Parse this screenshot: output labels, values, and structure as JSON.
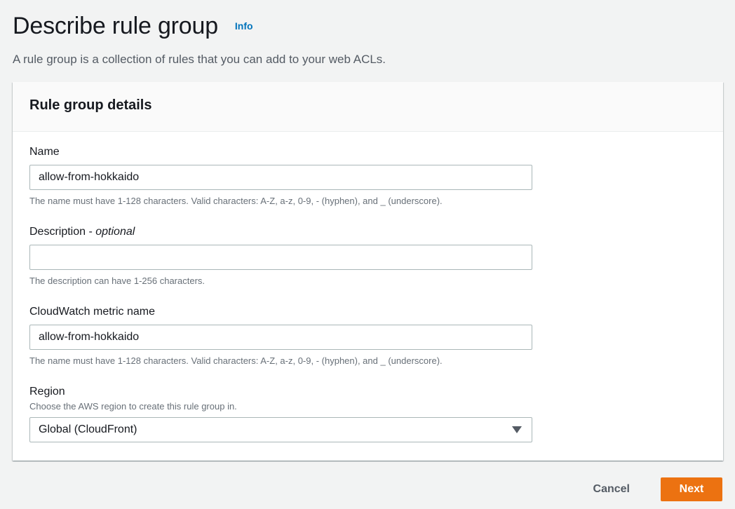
{
  "page": {
    "title": "Describe rule group",
    "info_link": "Info",
    "subtitle": "A rule group is a collection of rules that you can add to your web ACLs."
  },
  "panel": {
    "title": "Rule group details",
    "name": {
      "label": "Name",
      "value": "allow-from-hokkaido",
      "hint": "The name must have 1-128 characters. Valid characters: A-Z, a-z, 0-9, - (hyphen), and _ (underscore)."
    },
    "description": {
      "label": "Description - ",
      "label_optional": "optional",
      "value": "",
      "hint": "The description can have 1-256 characters."
    },
    "metric": {
      "label": "CloudWatch metric name",
      "value": "allow-from-hokkaido",
      "hint": "The name must have 1-128 characters. Valid characters: A-Z, a-z, 0-9, - (hyphen), and _ (underscore)."
    },
    "region": {
      "label": "Region",
      "description": "Choose the AWS region to create this rule group in.",
      "selected": "Global (CloudFront)"
    }
  },
  "actions": {
    "cancel_label": "Cancel",
    "next_label": "Next"
  },
  "colors": {
    "accent": "#ec7211",
    "link": "#0073bb",
    "background": "#f2f3f3"
  }
}
